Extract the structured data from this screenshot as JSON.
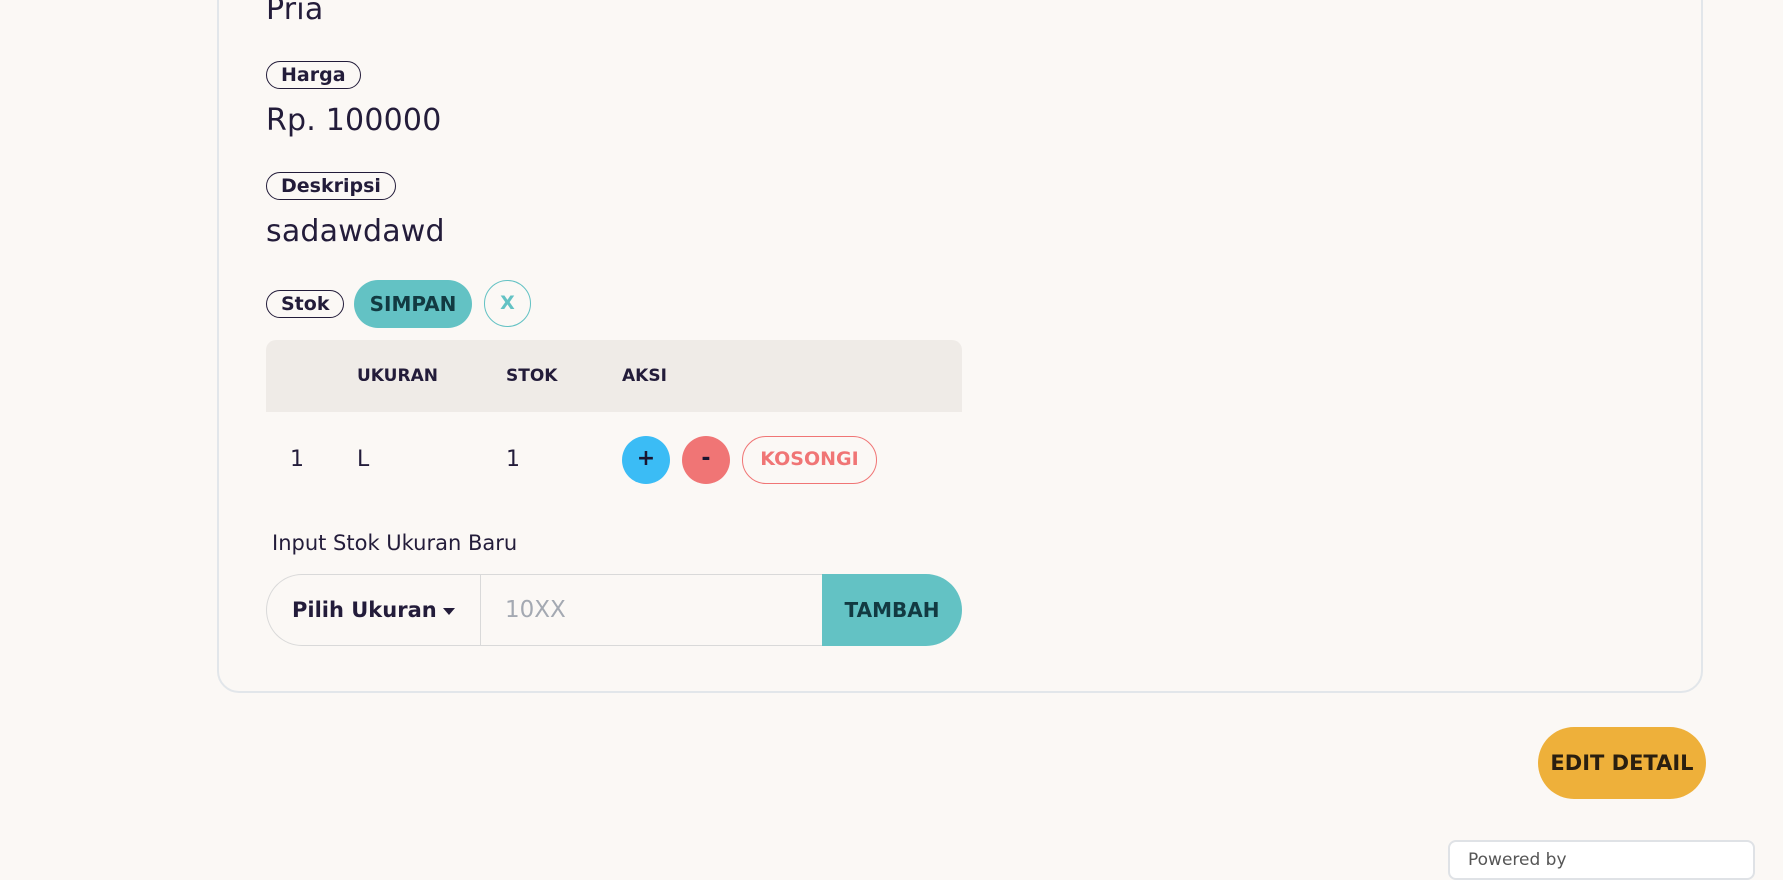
{
  "product": {
    "gender_value": "Pria",
    "price_label": "Harga",
    "price_value": "Rp. 100000",
    "description_label": "Deskripsi",
    "description_value": "sadawdawd",
    "stock_label": "Stok"
  },
  "stock_actions": {
    "save_label": "SIMPAN",
    "cancel_label": "X"
  },
  "stock_table": {
    "headers": [
      "",
      "UKURAN",
      "STOK",
      "AKSI"
    ],
    "rows": [
      {
        "no": "1",
        "size": "L",
        "stock": "1",
        "plus": "+",
        "minus": "-",
        "empty_label": "KOSONGI"
      }
    ]
  },
  "new_stock": {
    "label": "Input Stok Ukuran Baru",
    "size_select": "Pilih Ukuran",
    "stock_placeholder": "10XX",
    "add_label": "TAMBAH"
  },
  "edit_detail_label": "EDIT DETAIL",
  "footer": {
    "powered_by": "Powered by"
  },
  "colors": {
    "teal": "#63c2c4",
    "blue": "#3bbcf5",
    "red": "#f07575",
    "amber": "#eeb03a"
  }
}
